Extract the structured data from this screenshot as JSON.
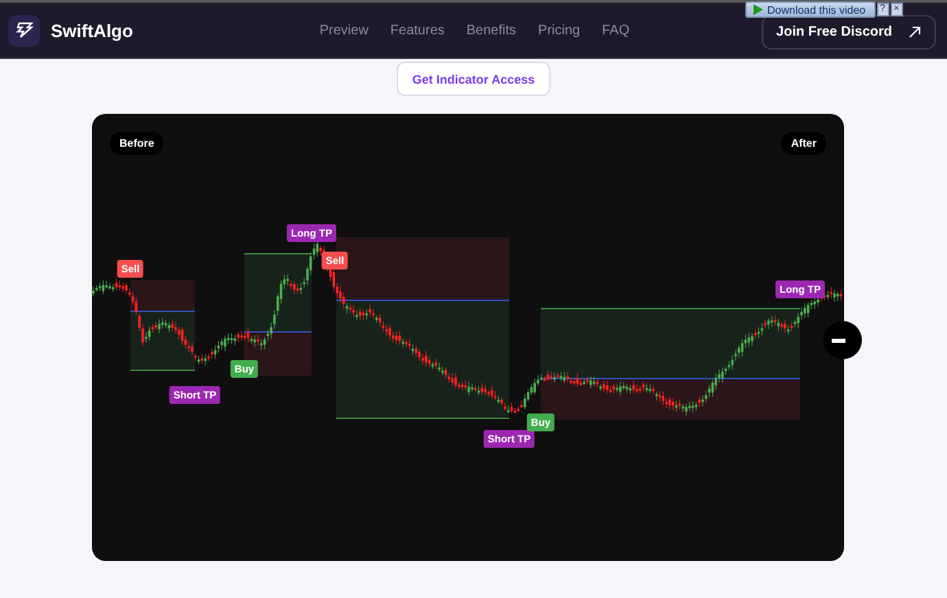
{
  "header": {
    "brand": "SwiftAlgo",
    "nav": [
      {
        "label": "Preview"
      },
      {
        "label": "Features"
      },
      {
        "label": "Benefits"
      },
      {
        "label": "Pricing"
      },
      {
        "label": "FAQ"
      }
    ],
    "cta": {
      "label": "Join Free Discord"
    }
  },
  "download_overlay": {
    "label": "Download this video",
    "help": "?",
    "close": "×"
  },
  "access_button": {
    "label": "Get Indicator Access"
  },
  "comparison": {
    "before_label": "Before",
    "after_label": "After",
    "signals": [
      {
        "kind": "sell",
        "label": "Sell"
      },
      {
        "kind": "short_tp",
        "label": "Short TP"
      },
      {
        "kind": "buy",
        "label": "Buy"
      },
      {
        "kind": "long_tp",
        "label": "Long TP"
      },
      {
        "kind": "sell",
        "label": "Sell"
      },
      {
        "kind": "short_tp",
        "label": "Short TP"
      },
      {
        "kind": "buy",
        "label": "Buy"
      },
      {
        "kind": "long_tp",
        "label": "Long TP"
      }
    ]
  }
}
